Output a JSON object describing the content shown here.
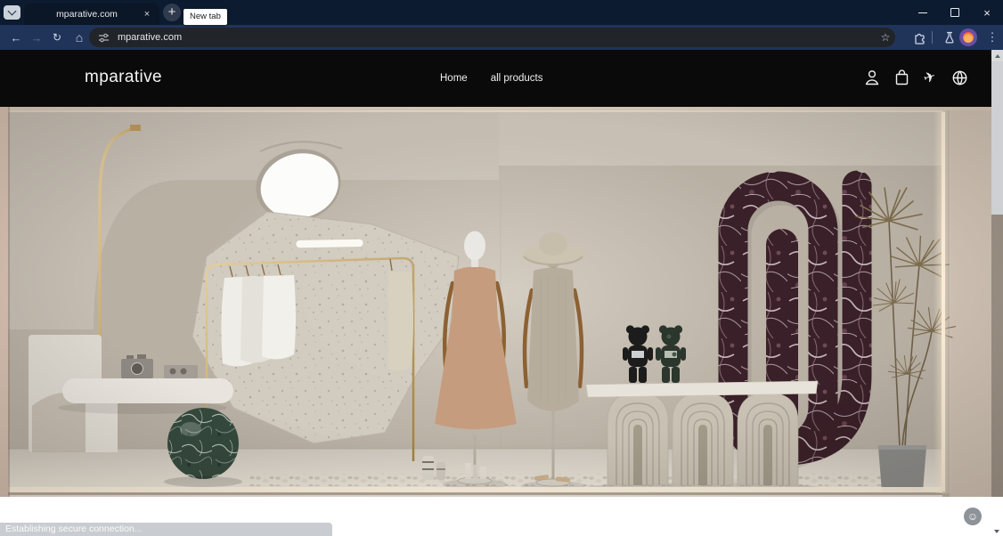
{
  "browser": {
    "tab": {
      "title": "mparative.com"
    },
    "new_tab_tooltip": "New tab",
    "address_bar": {
      "url": "mparative.com"
    },
    "theme": {
      "frame": "#0d1b30",
      "toolbar": "#20345a",
      "omnibox": "#212428",
      "active_tab": "#0b1626"
    }
  },
  "glyphs": {
    "close": "×",
    "plus": "+",
    "back": "←",
    "forward": "→",
    "reload": "↻",
    "home": "⌂",
    "star": "☆",
    "menu": "⋮",
    "plane": "✈",
    "smiley": "☺"
  },
  "site": {
    "logo": "mparative",
    "nav": [
      {
        "label": "Home"
      },
      {
        "label": "all products"
      }
    ],
    "header_bg": "#0a0a0a",
    "header_icons": [
      "account-icon",
      "shopping-bag-icon",
      "plane-icon",
      "globe-icon"
    ]
  },
  "status_bar": {
    "text": "Establishing secure connection..."
  },
  "page": {
    "background": "#ffffff"
  }
}
